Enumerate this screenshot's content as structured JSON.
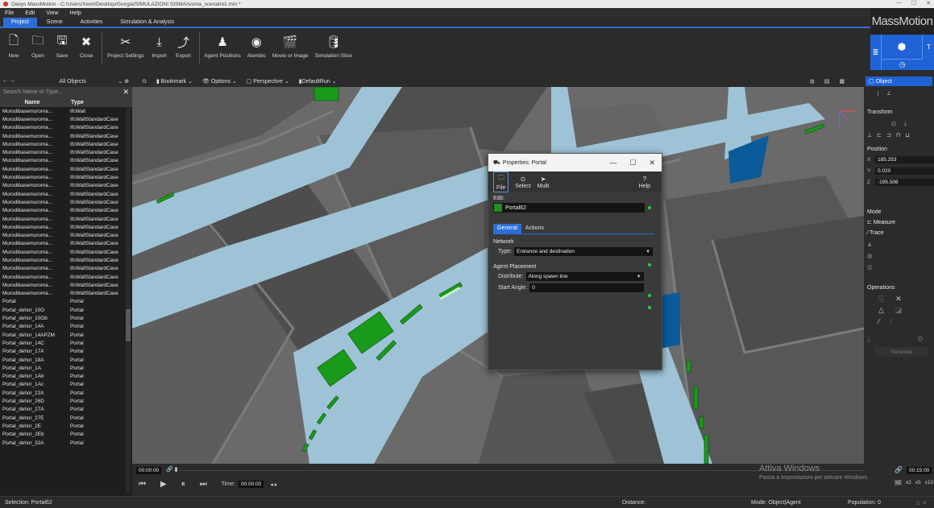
{
  "titlebar": {
    "title": "Oasys MassMotion - C:/Users/Xeon/Desktop/Giorgia/SIMULAZIONI SISMA/sisma_scenario1.mm *",
    "min": "—",
    "max": "☐",
    "close": "✕"
  },
  "menu": [
    "File",
    "Edit",
    "View",
    "Help"
  ],
  "ribbon_tabs": [
    "Project",
    "Scene",
    "Activities",
    "Simulation & Analysis"
  ],
  "toolbar": {
    "new": "New",
    "open": "Open",
    "save": "Save",
    "close": "Close",
    "project_settings": "Project Settings",
    "import": "Import",
    "export": "Export",
    "agent_positions": "Agent Positions",
    "alembic": "Alembic",
    "movie_or_image": "Movie or Image",
    "simulation_slice": "Simulation Slice"
  },
  "brand": "MassMotion",
  "left_panel": {
    "filter": "All Objects",
    "search_placeholder": "Search Name or Type...",
    "col_name": "Name",
    "col_type": "Type",
    "rows": [
      [
        "Murodibasemuroma...",
        "IfcWall"
      ],
      [
        "Murodibasemuroma...",
        "IfcWallStandardCase"
      ],
      [
        "Murodibasemuroma...",
        "IfcWallStandardCase"
      ],
      [
        "Murodibasemuroma...",
        "IfcWallStandardCase"
      ],
      [
        "Murodibasemuroma...",
        "IfcWallStandardCase"
      ],
      [
        "Murodibasemuroma...",
        "IfcWallStandardCase"
      ],
      [
        "Murodibasemuroma...",
        "IfcWallStandardCase"
      ],
      [
        "Murodibasemuroma...",
        "IfcWallStandardCase"
      ],
      [
        "Murodibasemuroma...",
        "IfcWallStandardCase"
      ],
      [
        "Murodibasemuroma...",
        "IfcWallStandardCase"
      ],
      [
        "Murodibasemuroma...",
        "IfcWallStandardCase"
      ],
      [
        "Murodibasemuroma...",
        "IfcWallStandardCase"
      ],
      [
        "Murodibasemuroma...",
        "IfcWallStandardCase"
      ],
      [
        "Murodibasemuroma...",
        "IfcWallStandardCase"
      ],
      [
        "Murodibasemuroma...",
        "IfcWallStandardCase"
      ],
      [
        "Murodibasemuroma...",
        "IfcWallStandardCase"
      ],
      [
        "Murodibasemuroma...",
        "IfcWallStandardCase"
      ],
      [
        "Murodibasemuroma...",
        "IfcWallStandardCase"
      ],
      [
        "Murodibasemuroma...",
        "IfcWallStandardCase"
      ],
      [
        "Murodibasemuroma...",
        "IfcWallStandardCase"
      ],
      [
        "Murodibasemuroma...",
        "IfcWallStandardCase"
      ],
      [
        "Murodibasemuroma...",
        "IfcWallStandardCase"
      ],
      [
        "Murodibasemuroma...",
        "IfcWallStandardCase"
      ],
      [
        "Portal",
        "Portal"
      ],
      [
        "Portal_dehor_10G",
        "Portal"
      ],
      [
        "Portal_dehor_10Gb",
        "Portal"
      ],
      [
        "Portal_dehor_14A",
        "Portal"
      ],
      [
        "Portal_dehor_14APZM",
        "Portal"
      ],
      [
        "Portal_dehor_14C",
        "Portal"
      ],
      [
        "Portal_dehor_17A",
        "Portal"
      ],
      [
        "Portal_dehor_18A",
        "Portal"
      ],
      [
        "Portal_dehor_1A",
        "Portal"
      ],
      [
        "Portal_dehor_1Ab",
        "Portal"
      ],
      [
        "Portal_dehor_1Ac",
        "Portal"
      ],
      [
        "Portal_dehor_22A",
        "Portal"
      ],
      [
        "Portal_dehor_26D",
        "Portal"
      ],
      [
        "Portal_dehor_27A",
        "Portal"
      ],
      [
        "Portal_dehor_27E",
        "Portal"
      ],
      [
        "Portal_dehor_2E",
        "Portal"
      ],
      [
        "Portal_dehor_2Eb",
        "Portal"
      ],
      [
        "Portal_dehor_32A",
        "Portal"
      ]
    ]
  },
  "viewport_toolbar": {
    "bookmark": "Bookmark",
    "options": "Options",
    "perspective": "Perspective",
    "run": "DefaultRun"
  },
  "dialog": {
    "title": "Properties: Portal",
    "tools": {
      "file": "File",
      "select": "Select",
      "multi": "Multi",
      "help": "Help"
    },
    "edit_label": "Edit:",
    "edit_value": "Portal62",
    "tabs": [
      "General",
      "Actions"
    ],
    "network_label": "Network",
    "type_label": "Type:",
    "type_value": "Entrance and destination",
    "agent_placement_label": "Agent Placement",
    "distribute_label": "Distribute:",
    "distribute_value": "Along spawn line",
    "start_angle_label": "Start Angle:",
    "start_angle_value": "0"
  },
  "right_panel": {
    "tab": "Object",
    "transform": "Transform",
    "position": "Position",
    "x": "185.253",
    "y": "0.020",
    "z": "-195.506",
    "mode": "Mode",
    "measure": "Measure",
    "trace": "Trace",
    "operations": "Operations",
    "generate": "Generate"
  },
  "timeline": {
    "current": "00:00:00",
    "time_label": "Time:",
    "time_value": "00:00:00",
    "end": "00:15:00",
    "speeds": [
      "x1",
      "x2",
      "x5",
      "x10",
      "x20"
    ]
  },
  "watermark": {
    "line1": "Attiva Windows",
    "line2": "Passa a Impostazioni per attivare Windows."
  },
  "status": {
    "selection": "Selection:  Portal62",
    "distance": "Distance:",
    "mode": "Mode:  Object|Agent",
    "population": "Population:  0"
  },
  "colors": {
    "accent": "#2d6ed6",
    "walkway": "#9ec3d6",
    "portal": "#1a9a1a",
    "deep_blue": "#0b5b9a"
  }
}
